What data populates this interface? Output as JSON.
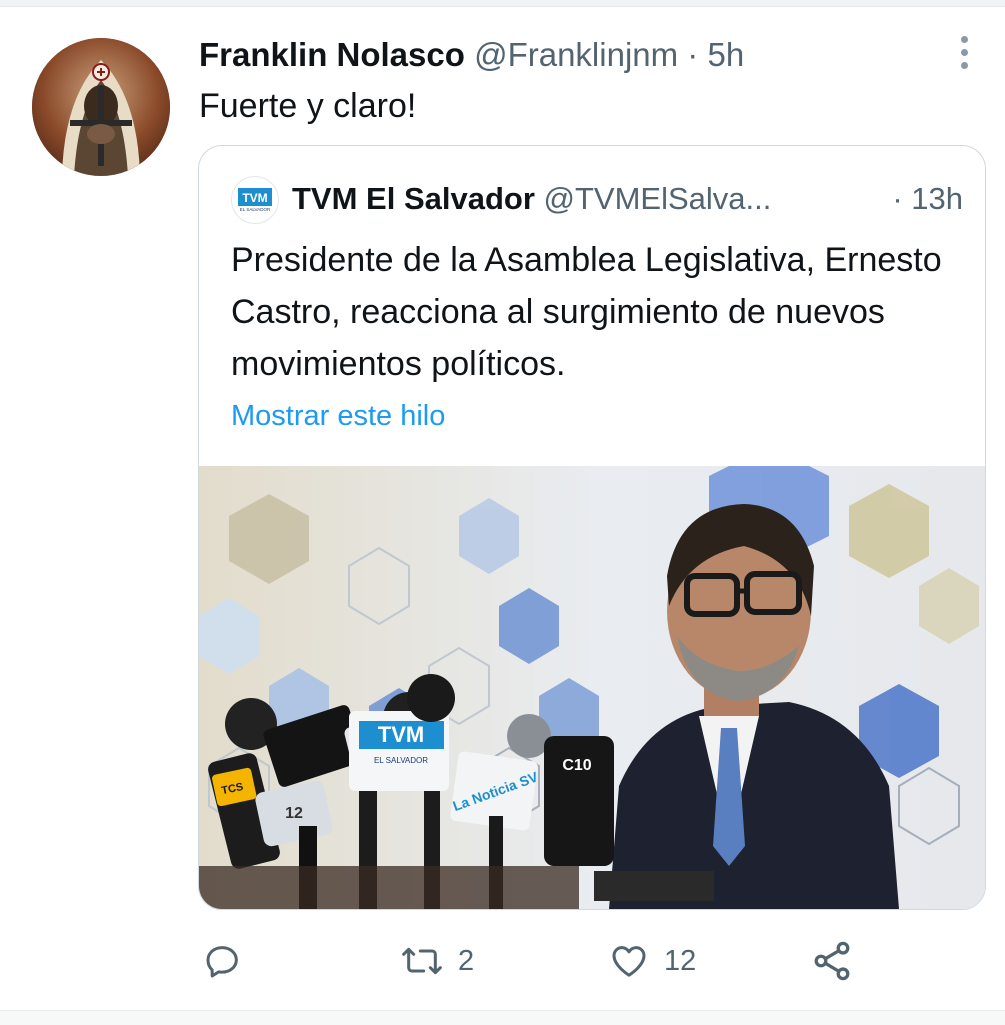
{
  "tweet": {
    "author_name": "Franklin Nolasco",
    "author_handle": "@Franklinjnm",
    "separator": "·",
    "time": "5h",
    "text": "Fuerte y claro!"
  },
  "quoted_tweet": {
    "author_name": "TVM El Salvador",
    "author_handle": "@TVMElSalva...",
    "separator": "·",
    "time": "13h",
    "text": "Presidente de la Asamblea Legislativa, Ernesto Castro, reacciona al surgimiento de nuevos movimientos políticos.",
    "show_thread_link": "Mostrar este hilo",
    "avatar_logo_text": "TVM",
    "avatar_logo_subtext": "EL SALVADOR",
    "media": {
      "mic_labels": [
        "TVM",
        "EL SALVADOR",
        "C10",
        "12",
        "La Noticia SV",
        "TCS"
      ]
    }
  },
  "actions": {
    "reply_count": "",
    "retweet_count": "2",
    "like_count": "12"
  },
  "colors": {
    "link": "#1d9bf0",
    "secondary_text": "#536471",
    "border": "#cfd9de"
  }
}
